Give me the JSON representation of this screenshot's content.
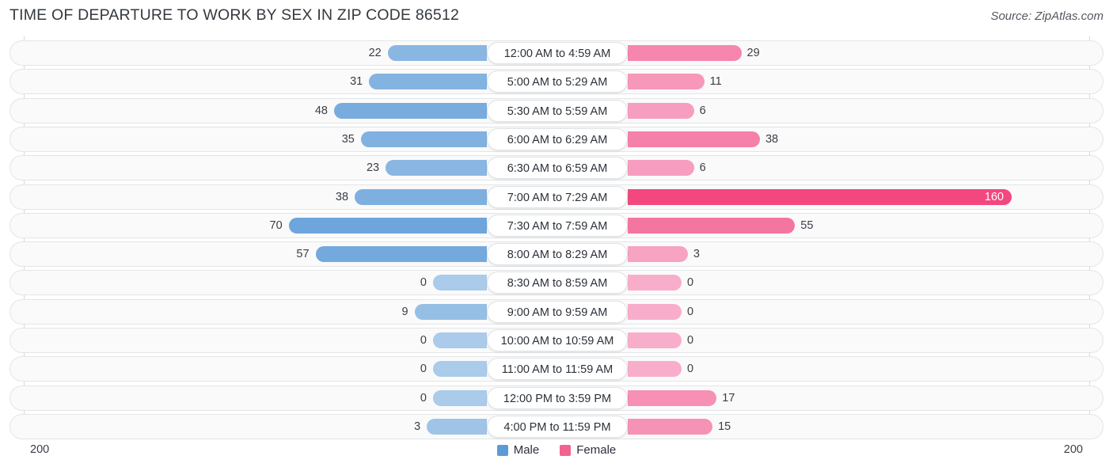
{
  "header": {
    "title": "TIME OF DEPARTURE TO WORK BY SEX IN ZIP CODE 86512",
    "source": "Source: ZipAtlas.com"
  },
  "legend": {
    "male": {
      "label": "Male",
      "color": "#5b9bd5"
    },
    "female": {
      "label": "Female",
      "color": "#f2648f"
    }
  },
  "axis": {
    "left_tick": "200",
    "right_tick": "200"
  },
  "chart_data": {
    "type": "bar",
    "orientation": "horizontal-diverging",
    "title": "TIME OF DEPARTURE TO WORK BY SEX IN ZIP CODE 86512",
    "xlabel": "",
    "ylabel": "",
    "xlim": [
      200,
      200
    ],
    "grid": false,
    "legend_position": "bottom-center",
    "categories": [
      "12:00 AM to 4:59 AM",
      "5:00 AM to 5:29 AM",
      "5:30 AM to 5:59 AM",
      "6:00 AM to 6:29 AM",
      "6:30 AM to 6:59 AM",
      "7:00 AM to 7:29 AM",
      "7:30 AM to 7:59 AM",
      "8:00 AM to 8:29 AM",
      "8:30 AM to 8:59 AM",
      "9:00 AM to 9:59 AM",
      "10:00 AM to 10:59 AM",
      "11:00 AM to 11:59 AM",
      "12:00 PM to 3:59 PM",
      "4:00 PM to 11:59 PM"
    ],
    "series": [
      {
        "name": "Male",
        "values": [
          22,
          31,
          48,
          35,
          23,
          38,
          70,
          57,
          0,
          9,
          0,
          0,
          0,
          3
        ]
      },
      {
        "name": "Female",
        "values": [
          29,
          11,
          6,
          38,
          6,
          160,
          55,
          3,
          0,
          0,
          0,
          0,
          17,
          15
        ]
      }
    ]
  },
  "rows": [
    {
      "category": "12:00 AM to 4:59 AM",
      "male": "22",
      "female": "29"
    },
    {
      "category": "5:00 AM to 5:29 AM",
      "male": "31",
      "female": "11"
    },
    {
      "category": "5:30 AM to 5:59 AM",
      "male": "48",
      "female": "6"
    },
    {
      "category": "6:00 AM to 6:29 AM",
      "male": "35",
      "female": "38"
    },
    {
      "category": "6:30 AM to 6:59 AM",
      "male": "23",
      "female": "6"
    },
    {
      "category": "7:00 AM to 7:29 AM",
      "male": "38",
      "female": "160"
    },
    {
      "category": "7:30 AM to 7:59 AM",
      "male": "70",
      "female": "55"
    },
    {
      "category": "8:00 AM to 8:29 AM",
      "male": "57",
      "female": "3"
    },
    {
      "category": "8:30 AM to 8:59 AM",
      "male": "0",
      "female": "0"
    },
    {
      "category": "9:00 AM to 9:59 AM",
      "male": "9",
      "female": "0"
    },
    {
      "category": "10:00 AM to 10:59 AM",
      "male": "0",
      "female": "0"
    },
    {
      "category": "11:00 AM to 11:59 AM",
      "male": "0",
      "female": "0"
    },
    {
      "category": "12:00 PM to 3:59 PM",
      "male": "0",
      "female": "17"
    },
    {
      "category": "4:00 PM to 11:59 PM",
      "male": "3",
      "female": "15"
    }
  ]
}
